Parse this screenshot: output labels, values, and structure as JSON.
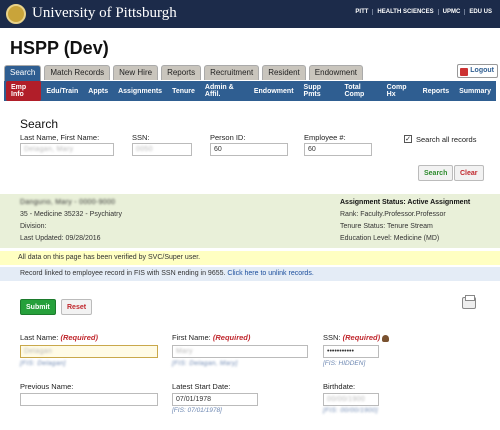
{
  "header": {
    "brand": "University of Pittsburgh",
    "links": [
      "PITT",
      "HEALTH SCIENCES",
      "UPMC",
      "EDU US"
    ]
  },
  "app": {
    "title": "HSPP (Dev)",
    "logout": "Logout"
  },
  "tabs": [
    "Search",
    "Match Records",
    "New Hire",
    "Reports",
    "Recruitment",
    "Resident",
    "Endowment"
  ],
  "subnav": [
    "Emp Info",
    "Edu/Train",
    "Appts",
    "Assignments",
    "Tenure",
    "Admin & Affil.",
    "Endowment",
    "Supp Pmts",
    "Total Comp",
    "Comp Hx",
    "Reports",
    "Summary"
  ],
  "search": {
    "title": "Search",
    "name_label": "Last Name, First Name:",
    "name_value": "Delagan, Mary",
    "ssn_label": "SSN:",
    "ssn_value": "0050",
    "person_id_label": "Person ID:",
    "person_id_value": "60",
    "employee_label": "Employee #:",
    "employee_value": "60",
    "search_all_label": "Search all records",
    "search_button": "Search",
    "clear_button": "Clear"
  },
  "summary": {
    "name": "Dangurio, Mary - 0000-9000",
    "dept": "35 - Medicine 35232 - Psychiatry",
    "division": "Division:",
    "last_updated": "Last Updated: 09/28/2016",
    "assignment_status": "Assignment Status: Active Assignment",
    "rank": "Rank: Faculty.Professor.Professor",
    "tenure": "Tenure Status: Tenure Stream",
    "education": "Education Level: Medicine (MD)"
  },
  "notices": {
    "verified": "All data on this page has been verified by SVC/Super user.",
    "linked": "Record linked to employee record in FIS with SSN ending in 9655.",
    "unlink": "Click here to unlink records."
  },
  "form": {
    "submit": "Submit",
    "reset": "Reset",
    "required": "(Required)",
    "last_name_label": "Last Name:",
    "last_name_value": "Delagan",
    "last_name_hint": "[FIS: Delagan]",
    "first_name_label": "First Name:",
    "first_name_value": "Mary",
    "first_name_hint": "[FIS: Delagan, Mary]",
    "ssn_label": "SSN:",
    "ssn_value": "•••••••••••",
    "ssn_hint": "[FIS: HIDDEN]",
    "previous_name_label": "Previous Name:",
    "latest_start_label": "Latest Start Date:",
    "latest_start_value": "07/01/1978",
    "latest_start_hint": "[FIS: 07/01/1978]",
    "birthdate_label": "Birthdate:",
    "birthdate_value": "00/00/1900",
    "birthdate_hint": "[FIS: 00/00/1900]"
  }
}
